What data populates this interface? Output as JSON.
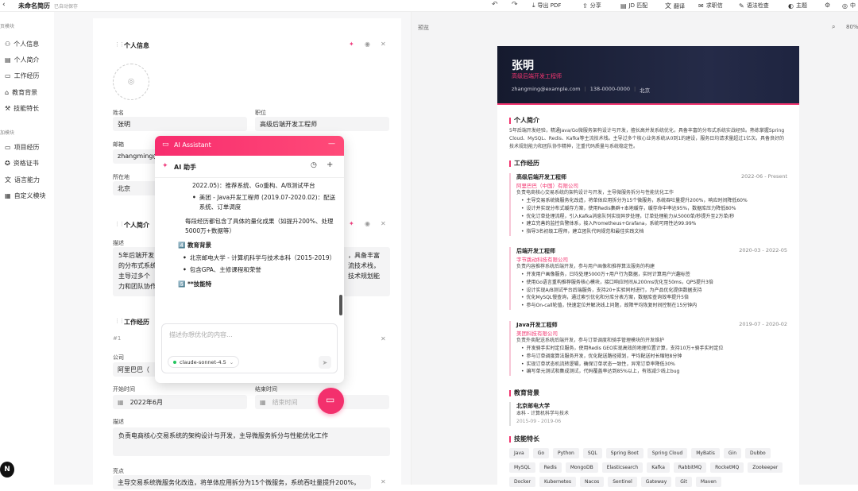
{
  "app": {
    "doc_title": "未命名简历",
    "save_status": "已自动保存"
  },
  "toolbar": {
    "items": [
      {
        "label": "导出 PDF",
        "icon": "download-icon"
      },
      {
        "label": "分享",
        "icon": "share-icon"
      },
      {
        "label": "JD 匹配",
        "icon": "document-icon"
      },
      {
        "label": "翻译",
        "icon": "translate-icon"
      },
      {
        "label": "求职信",
        "icon": "letter-icon"
      },
      {
        "label": "语法检查",
        "icon": "grammar-icon"
      },
      {
        "label": "主题",
        "icon": "palette-icon"
      },
      {
        "label": "中",
        "icon": "globe-icon"
      }
    ]
  },
  "sidebar": {
    "section1": "页模块",
    "items1": [
      "个人信息",
      "个人简介",
      "工作经历",
      "教育背景",
      "技能特长"
    ],
    "section2": "加模块",
    "items2": [
      "项目经历",
      "资格证书",
      "语言能力",
      "自定义模块"
    ]
  },
  "editor": {
    "personal": {
      "title": "个人信息",
      "name_label": "姓名",
      "name_value": "张明",
      "position_label": "职位",
      "position_value": "高级后端开发工程师",
      "email_label": "邮箱",
      "email_value": "zhangming@",
      "location_label": "所在地",
      "location_value": "北京"
    },
    "intro": {
      "title": "个人简介",
      "desc_label": "描述",
      "text_lines": [
        "5年后端开发",
        "的分布式系统",
        "主导过多个",
        "力和团队协作"
      ],
      "text_right": [
        "，具备丰富",
        "流技术栈，",
        "技术规划能"
      ]
    },
    "work": {
      "title": "工作经历",
      "index": "#1",
      "company_label": "公司",
      "company_value": "阿里巴巴（",
      "start_label": "开始时间",
      "start_value": "2022年6月",
      "end_label": "结束时间",
      "end_placeholder": "结束时间",
      "desc_label": "描述",
      "desc_value": "负责电商核心交易系统的架构设计与开发，主导微服务拆分与性能优化工作",
      "highlights_label": "亮点",
      "highlight_value": "主导交易系统微服务化改造，将单体应用拆分为15个微服务，系统吞吐量提升200%，"
    }
  },
  "ai": {
    "header": "AI Assistant",
    "title": "AI 助手",
    "body": {
      "line1": "2022.05)：推荐系统、Go重构、A/B测试平台",
      "bullet1": "美团 - Java开发工程师 (2019.07-2020.02)：配送系统、订单调度",
      "para": "每段经历都包含了具体的量化成果（如提升200%、处理5000万+数据等）",
      "edu_head": "4️⃣ 教育背景",
      "edu1": "北京邮电大学 - 计算机科学与技术本科（2015-2019）",
      "edu2": "包含GPA、主修课程和荣誉",
      "skill_head": "5️⃣ **技能特"
    },
    "input_placeholder": "描述你想优化的内容...",
    "model": "claude-sonnet-4.5"
  },
  "preview": {
    "label": "预览",
    "zoom": "80%",
    "name": "张明",
    "job_title": "高级后端开发工程师",
    "contact": [
      "zhangming@example.com",
      "138-0000-0000",
      "北京"
    ],
    "intro_title": "个人简介",
    "intro_text": "5年后端开发经验，精通Java/Go微服务架构设计与开发，擅长高并发系统优化，具备丰富的分布式系统实战经验。熟练掌握Spring Cloud、MySQL、Redis、Kafka等主流技术栈。主导过多个核心业务系统从0到1的建设，服务日均请求量超过1亿次。具备良好的技术规划能力和团队协作精神，注重代码质量与系统稳定性。",
    "work_title": "工作经历",
    "jobs": [
      {
        "title": "高级后端开发工程师",
        "date": "2022-06 - Present",
        "company": "阿里巴巴（中国）有限公司",
        "desc": "负责电商核心交易系统的架构设计与开发，主导微服务拆分与性能优化工作",
        "bullets": [
          "主导交易系统微服务化改造，将单体应用拆分为15个微服务，系统吞吐量提升200%，响应时间降低60%",
          "设计并实现分布式缓存方案，使用Redis集群+本地缓存，缓存命中率达95%，数据库压力降低80%",
          "优化订单处理流程，引入Kafka消息队列实现异步处理，订单处理能力从5000单/秒提升至2万单/秒",
          "建立完善的监控告警体系，接入Prometheus+Grafana，系统可用性达99.99%",
          "指导3名初级工程师，建立团队代码规范和最佳实践文档"
        ]
      },
      {
        "title": "后端开发工程师",
        "date": "2020-03 - 2022-05",
        "company": "字节跳动科技有限公司",
        "desc": "负责内容推荐系统后端开发，参与用户画像和推荐算法服务的构建",
        "bullets": [
          "开发用户画像服务，日均处理5000万+用户行为数据，实时计算用户兴趣标签",
          "使用Go语言重构推荐服务核心模块，接口响应时间从200ms优化至50ms，QPS提升3倍",
          "设计实现A/B测试平台后端服务，支持20+实验同时进行，为产品优化提供数据支持",
          "优化MySQL慢查询，通过索引优化和分库分表方案，数据库查询效率提升5倍",
          "参与On-call轮值，快速定位并解决线上问题，故障平均恢复时间控制在15分钟内"
        ]
      },
      {
        "title": "Java开发工程师",
        "date": "2019-07 - 2020-02",
        "company": "美团科技有限公司",
        "desc": "负责外卖配送系统后端开发，参与订单调度和骑手管理模块的开发维护",
        "bullets": [
          "开发骑手实时定位服务，使用Redis GEO实现高效的地理位置计算，支持10万+骑手实时定位",
          "参与订单调度算法服务开发，优化配送路径规划，平均配送时长缩短8分钟",
          "实现订单状态机流转逻辑，确保订单状态一致性，异常订单率降低30%",
          "编写单元测试和集成测试，代码覆盖率达到85%以上，有效减少线上bug"
        ]
      }
    ],
    "edu_title": "教育背景",
    "edu": {
      "school": "北京邮电大学",
      "degree": "本科 - 计算机科学与技术",
      "date": "2015-09 - 2019-06"
    },
    "skills_title": "技能特长",
    "skills": [
      "Java",
      "Go",
      "Python",
      "SQL",
      "Spring Boot",
      "Spring Cloud",
      "MyBatis",
      "Gin",
      "Dubbo",
      "MySQL",
      "Redis",
      "MongoDB",
      "Elasticsearch",
      "Kafka",
      "RabbitMQ",
      "RocketMQ",
      "Zookeeper",
      "Docker",
      "Kubernetes",
      "Nacos",
      "Sentinel",
      "Gateway",
      "Git",
      "Maven"
    ]
  },
  "colors": {
    "accent": "#f23570",
    "header_dark": "#1b2038"
  }
}
